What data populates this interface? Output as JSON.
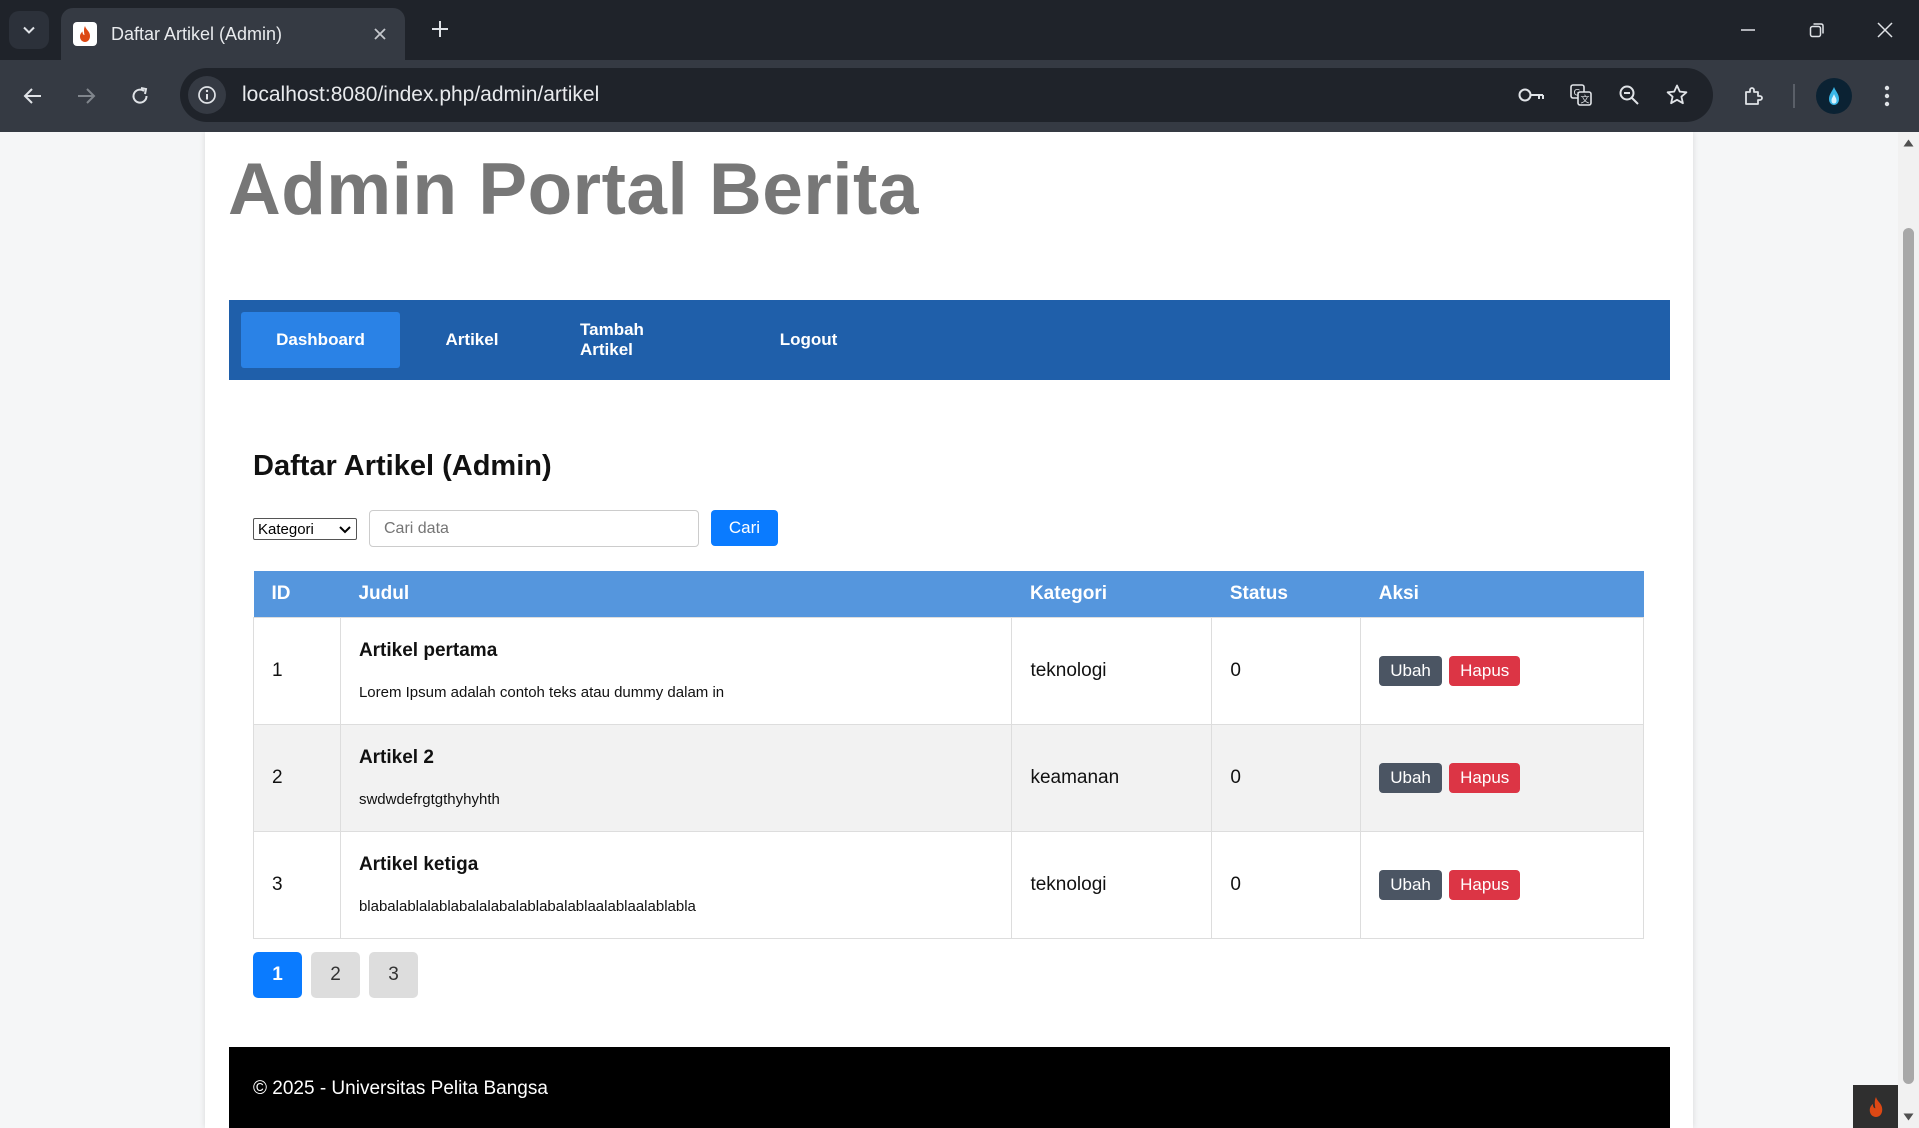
{
  "browser": {
    "tab_title": "Daftar Artikel (Admin)",
    "url_host": "localhost",
    "url_rest": ":8080/index.php/admin/artikel"
  },
  "site": {
    "title": "Admin Portal Berita"
  },
  "nav": {
    "items": [
      {
        "label": "Dashboard",
        "active": true
      },
      {
        "label": "Artikel",
        "active": false
      },
      {
        "label": "Tambah Artikel",
        "active": false
      },
      {
        "label": "Logout",
        "active": false
      }
    ]
  },
  "content": {
    "heading": "Daftar Artikel (Admin)",
    "filter": {
      "category_selected": "Kategori",
      "search_placeholder": "Cari data",
      "search_button": "Cari"
    }
  },
  "table": {
    "headers": [
      "ID",
      "Judul",
      "Kategori",
      "Status",
      "Aksi"
    ],
    "rows": [
      {
        "id": "1",
        "title": "Artikel pertama",
        "excerpt": "Lorem Ipsum adalah contoh teks atau dummy dalam in",
        "category": "teknologi",
        "status": "0",
        "edit": "Ubah",
        "delete": "Hapus"
      },
      {
        "id": "2",
        "title": "Artikel 2",
        "excerpt": "swdwdefrgtgthyhyhth",
        "category": "keamanan",
        "status": "0",
        "edit": "Ubah",
        "delete": "Hapus"
      },
      {
        "id": "3",
        "title": "Artikel ketiga",
        "excerpt": "blabalablalablabalalabalablabalablaalablaalablabla",
        "category": "teknologi",
        "status": "0",
        "edit": "Ubah",
        "delete": "Hapus"
      }
    ]
  },
  "pagination": {
    "pages": [
      "1",
      "2",
      "3"
    ],
    "current": "1"
  },
  "footer": {
    "text": "© 2025 - Universitas Pelita Bangsa"
  },
  "colors": {
    "navbar": "#1f5faa",
    "nav_active": "#2a82e6",
    "table_header": "#5596dd",
    "primary_button": "#0a7bff",
    "edit_button": "#4b5563",
    "delete_button": "#dc3545"
  },
  "icons": [
    "tab-search-icon",
    "codeigniter-flame-icon",
    "close-icon",
    "plus-icon",
    "minimize-icon",
    "restore-icon",
    "back-arrow-icon",
    "forward-arrow-icon",
    "reload-icon",
    "site-info-icon",
    "password-key-icon",
    "translate-icon",
    "zoom-icon",
    "bookmark-star-icon",
    "extensions-icon",
    "profile-avatar-icon",
    "kebab-menu-icon",
    "chevron-down-icon"
  ]
}
